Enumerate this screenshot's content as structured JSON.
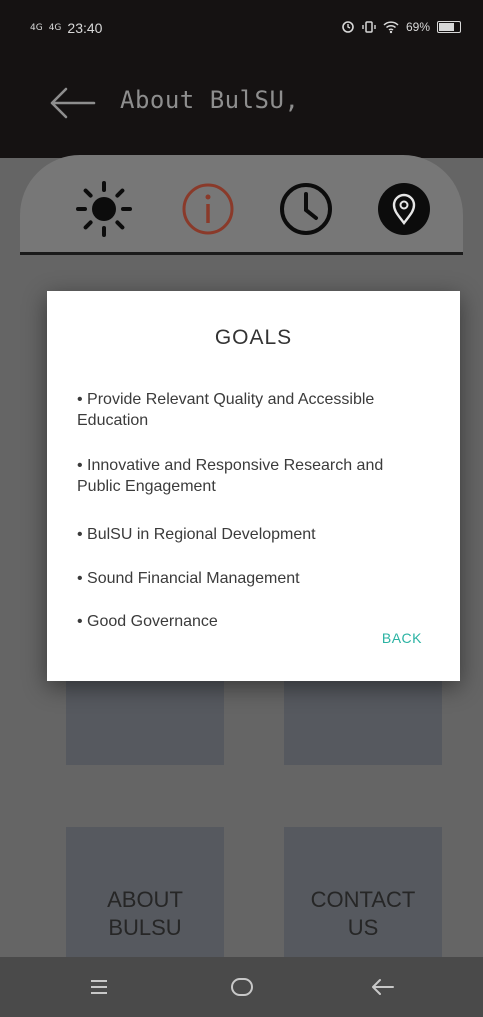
{
  "status_bar": {
    "signal1": "4G",
    "signal2": "4G",
    "time": "23:40",
    "battery": "69%",
    "battery_level": 0.69
  },
  "appbar": {
    "title": "About BulSU,"
  },
  "icon_tabs": [
    {
      "name": "sun-icon"
    },
    {
      "name": "info-icon",
      "color": "#8a3a2a"
    },
    {
      "name": "clock-icon"
    },
    {
      "name": "location-icon"
    }
  ],
  "tiles": {
    "about": [
      "ABOUT",
      "BULSU"
    ],
    "contact": [
      "CONTACT",
      "US"
    ]
  },
  "dialog": {
    "title": "GOALS",
    "goals": [
      [
        "• Provide Relevant Quality and Accessible",
        "Education"
      ],
      [
        "• Innovative and Responsive Research and",
        "Public Engagement"
      ],
      [
        "• BulSU in Regional Development"
      ],
      [
        "• Sound Financial Management"
      ],
      [
        "• Good Governance"
      ]
    ],
    "back_label": "BACK",
    "accent": "#2bb3a3"
  }
}
